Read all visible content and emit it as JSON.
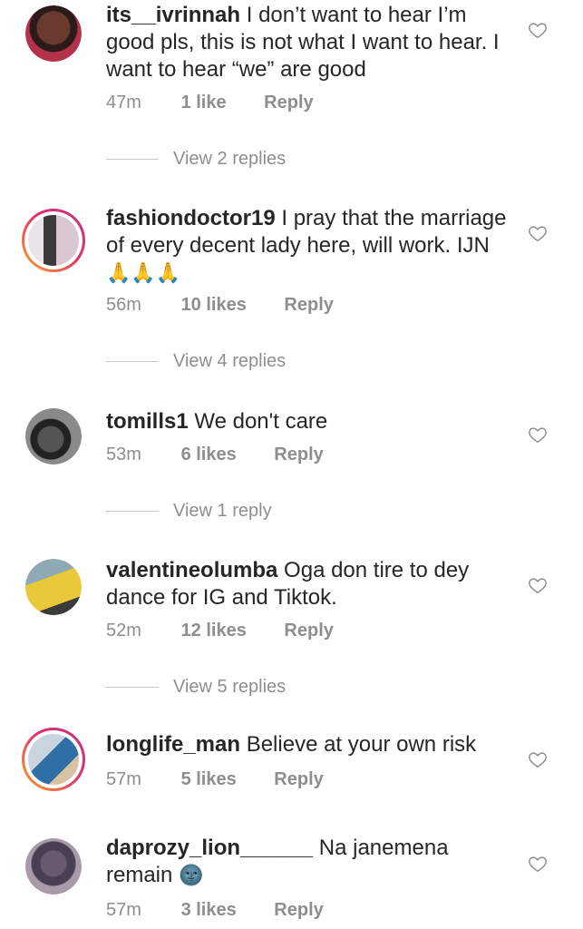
{
  "comments": [
    {
      "username": "its__ivrinnah",
      "text": "I don’t want to hear I’m good pls, this is not what I want to hear. I want to hear “we” are good",
      "time": "47m",
      "likes": "1 like",
      "reply": "Reply",
      "view_replies": "View 2 replies",
      "has_story_ring": false
    },
    {
      "username": "fashiondoctor19",
      "text": "I pray that the marriage of every decent lady here, will work. IJN",
      "emoji": "🙏🙏🙏",
      "time": "56m",
      "likes": "10 likes",
      "reply": "Reply",
      "view_replies": "View 4 replies",
      "has_story_ring": true
    },
    {
      "username": "tomills1",
      "text": "We don't care",
      "time": "53m",
      "likes": "6 likes",
      "reply": "Reply",
      "view_replies": "View 1 reply",
      "has_story_ring": false
    },
    {
      "username": "valentineolumba",
      "text": "Oga don tire to dey dance for IG and Tiktok.",
      "time": "52m",
      "likes": "12 likes",
      "reply": "Reply",
      "view_replies": "View 5 replies",
      "has_story_ring": false
    },
    {
      "username": "longlife_man",
      "text": "Believe at your own risk",
      "time": "57m",
      "likes": "5 likes",
      "reply": "Reply",
      "has_story_ring": true
    },
    {
      "username": "daprozy_lion______",
      "text": "Na janemena remain",
      "emoji": "🌚",
      "time": "57m",
      "likes": "3 likes",
      "reply": "Reply",
      "has_story_ring": false
    }
  ],
  "icons": {
    "like": "heart-outline-icon"
  },
  "colors": {
    "text": "#262626",
    "secondary": "#8e8e8e",
    "story_ring_start": "#f9a825",
    "story_ring_end": "#c13584"
  }
}
